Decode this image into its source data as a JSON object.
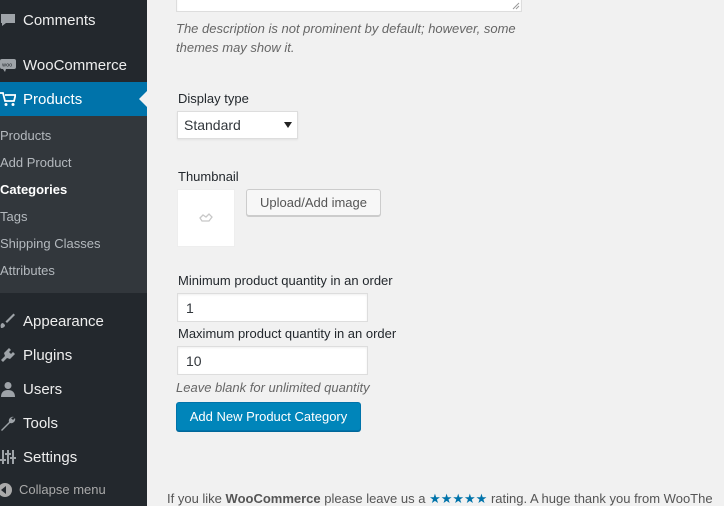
{
  "sidebar": {
    "top_items": [
      {
        "label": "Comments",
        "icon": "comments-icon"
      },
      {
        "label": "WooCommerce",
        "icon": "woocommerce-icon"
      },
      {
        "label": "Products",
        "icon": "cart-icon"
      }
    ],
    "submenu": [
      "Products",
      "Add Product",
      "Categories",
      "Tags",
      "Shipping Classes",
      "Attributes"
    ],
    "current_submenu": "Categories",
    "bottom_items": [
      {
        "label": "Appearance",
        "icon": "paintbrush-icon"
      },
      {
        "label": "Plugins",
        "icon": "plug-icon"
      },
      {
        "label": "Users",
        "icon": "user-icon"
      },
      {
        "label": "Tools",
        "icon": "wrench-icon"
      },
      {
        "label": "Settings",
        "icon": "sliders-icon"
      }
    ],
    "collapse_label": "Collapse menu"
  },
  "form": {
    "description_hint_line1": "The description is not prominent by default; however, some",
    "description_hint_line2": "themes may show it.",
    "display_type_label": "Display type",
    "display_type_value": "Standard",
    "thumbnail_label": "Thumbnail",
    "upload_button": "Upload/Add image",
    "min_qty_label": "Minimum product quantity in an order",
    "min_qty_value": "1",
    "max_qty_label": "Maximum product quantity in an order",
    "max_qty_value": "10",
    "qty_hint": "Leave blank for unlimited quantity",
    "submit_button": "Add New Product Category"
  },
  "footer": {
    "text_before": "If you like ",
    "brand": "WooCommerce",
    "text_middle": " please leave us a ",
    "stars": "★★★★★",
    "text_after": " rating. A huge thank you from WooThe"
  },
  "colors": {
    "sidebar_bg": "#23282d",
    "submenu_bg": "#32373c",
    "active_blue": "#0073aa",
    "primary_button": "#0085ba",
    "page_bg": "#f1f1f1"
  }
}
